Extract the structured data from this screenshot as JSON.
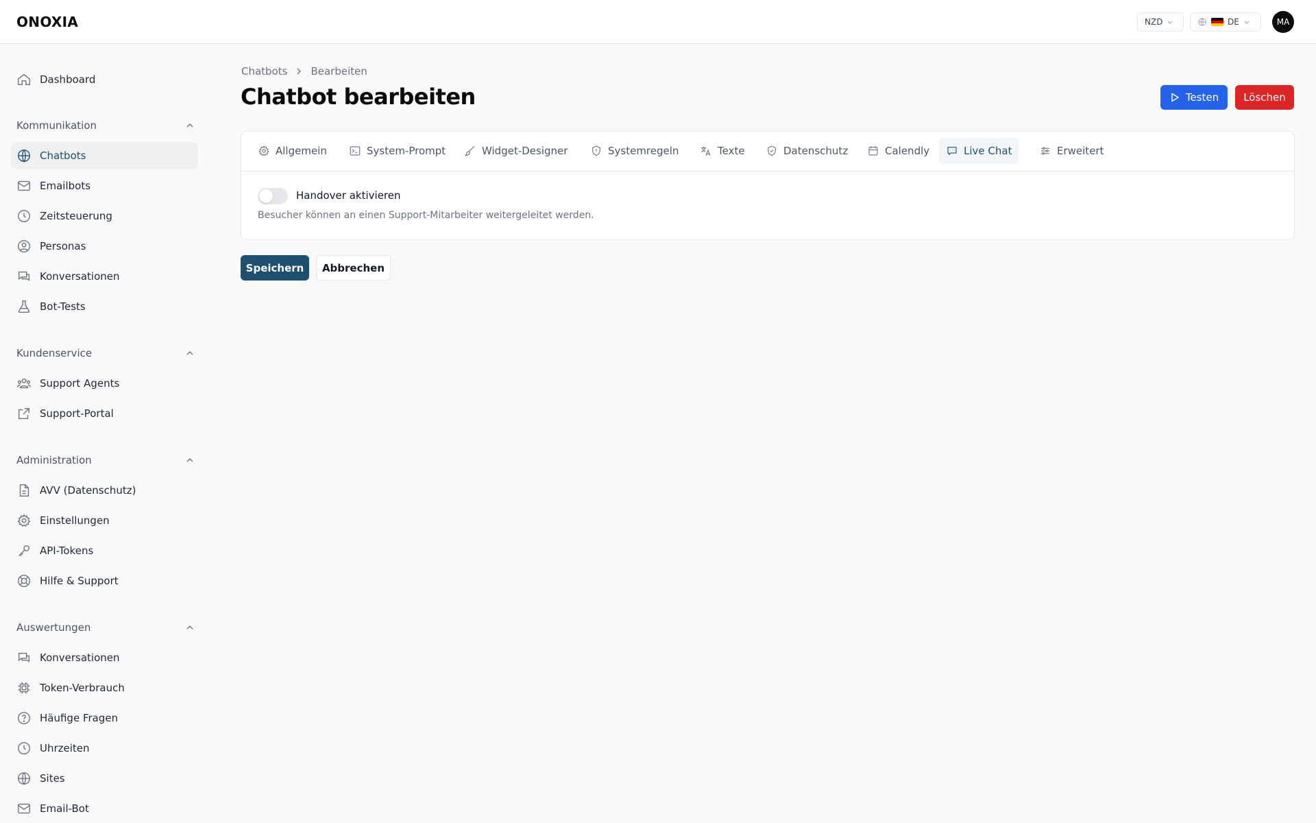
{
  "header": {
    "logo": "ONOXIA",
    "currency": "NZD",
    "language": "DE",
    "avatar_initials": "MA"
  },
  "sidebar": {
    "top_items": [
      {
        "label": "Dashboard",
        "icon": "home-icon"
      }
    ],
    "sections": [
      {
        "title": "Kommunikation",
        "items": [
          {
            "label": "Chatbots",
            "icon": "globe-icon",
            "active": true
          },
          {
            "label": "Emailbots",
            "icon": "mail-icon"
          },
          {
            "label": "Zeitsteuerung",
            "icon": "clock-icon"
          },
          {
            "label": "Personas",
            "icon": "user-circle-icon"
          },
          {
            "label": "Konversationen",
            "icon": "chat-icon"
          },
          {
            "label": "Bot-Tests",
            "icon": "flask-icon"
          }
        ]
      },
      {
        "title": "Kundenservice",
        "items": [
          {
            "label": "Support Agents",
            "icon": "users-icon"
          },
          {
            "label": "Support-Portal",
            "icon": "external-link-icon"
          }
        ]
      },
      {
        "title": "Administration",
        "items": [
          {
            "label": "AVV (Datenschutz)",
            "icon": "document-icon"
          },
          {
            "label": "Einstellungen",
            "icon": "gear-icon"
          },
          {
            "label": "API-Tokens",
            "icon": "key-icon"
          },
          {
            "label": "Hilfe & Support",
            "icon": "lifebuoy-icon"
          }
        ]
      },
      {
        "title": "Auswertungen",
        "items": [
          {
            "label": "Konversationen",
            "icon": "chat-icon"
          },
          {
            "label": "Token-Verbrauch",
            "icon": "chip-icon"
          },
          {
            "label": "Häufige Fragen",
            "icon": "question-icon"
          },
          {
            "label": "Uhrzeiten",
            "icon": "clock-icon"
          },
          {
            "label": "Sites",
            "icon": "globe-icon"
          },
          {
            "label": "Email-Bot",
            "icon": "mail-icon"
          }
        ]
      }
    ]
  },
  "main": {
    "breadcrumb": [
      "Chatbots",
      "Bearbeiten"
    ],
    "title": "Chatbot bearbeiten",
    "actions": {
      "test": "Testen",
      "delete": "Löschen"
    },
    "tabs": [
      {
        "label": "Allgemein",
        "icon": "gear-icon"
      },
      {
        "label": "System-Prompt",
        "icon": "terminal-icon"
      },
      {
        "label": "Widget-Designer",
        "icon": "brush-icon"
      },
      {
        "label": "Systemregeln",
        "icon": "shield-alert-icon"
      },
      {
        "label": "Texte",
        "icon": "translate-icon"
      },
      {
        "label": "Datenschutz",
        "icon": "shield-check-icon"
      },
      {
        "label": "Calendly",
        "icon": "calendar-icon"
      },
      {
        "label": "Live Chat",
        "icon": "chat-bubble-icon",
        "active": true
      },
      {
        "label": "Erweitert",
        "icon": "sliders-icon"
      }
    ],
    "handover": {
      "label": "Handover aktivieren",
      "description": "Besucher können an einen Support-Mitarbeiter weitergeleitet werden.",
      "enabled": false
    },
    "form_actions": {
      "save": "Speichern",
      "cancel": "Abbrechen"
    }
  },
  "colors": {
    "primary": "#1d4f70",
    "test_button": "#2563eb",
    "delete_button": "#dc2626",
    "active_nav_bg": "#eff0f2"
  }
}
